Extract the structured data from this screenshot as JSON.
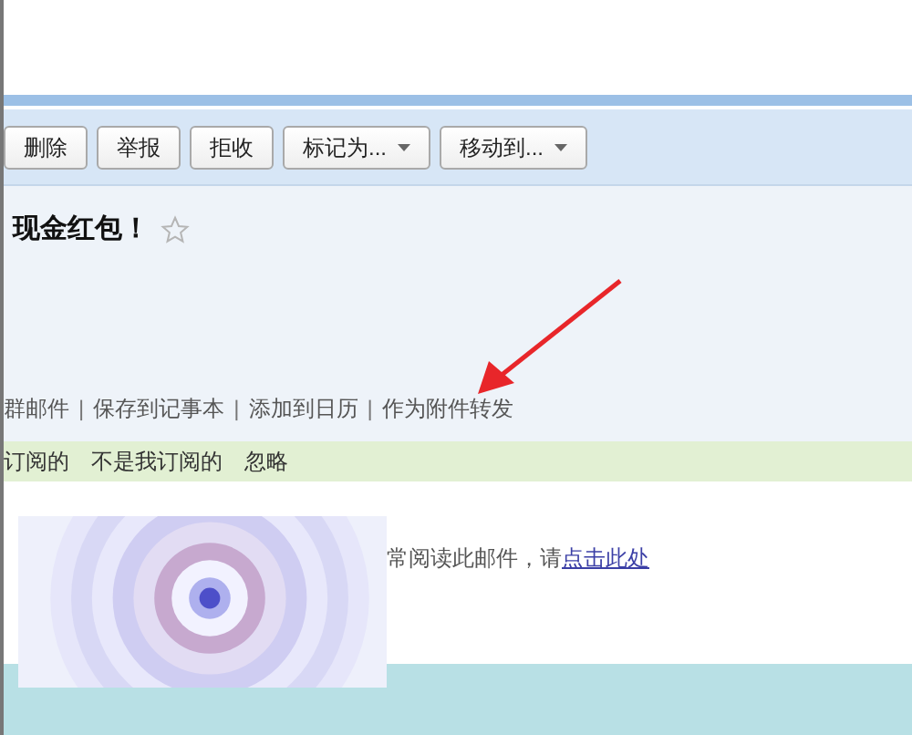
{
  "toolbar": {
    "buttons": [
      {
        "label": "删除",
        "kind": "plain"
      },
      {
        "label": "举报",
        "kind": "plain"
      },
      {
        "label": "拒收",
        "kind": "plain"
      },
      {
        "label": "标记为...",
        "kind": "dropdown"
      },
      {
        "label": "移动到...",
        "kind": "dropdown"
      }
    ]
  },
  "mail": {
    "subject": "现金红包！",
    "starred": false,
    "actions": [
      "群邮件",
      "保存到记事本",
      "添加到日历",
      "作为附件转发"
    ],
    "separator": "|"
  },
  "subscription_bar": {
    "links": [
      "订阅的",
      "不是我订阅的",
      "忽略"
    ]
  },
  "body": {
    "notice": "常阅读此邮件，请",
    "link": "点击此处"
  }
}
